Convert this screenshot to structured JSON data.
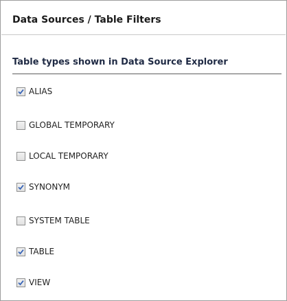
{
  "page": {
    "title": "Data Sources / Table Filters"
  },
  "group": {
    "title": "Table types shown in Data Source Explorer"
  },
  "options": [
    {
      "label": "ALIAS",
      "checked": true
    },
    {
      "label": "GLOBAL TEMPORARY",
      "checked": false
    },
    {
      "label": "LOCAL TEMPORARY",
      "checked": false
    },
    {
      "label": "SYNONYM",
      "checked": true
    },
    {
      "label": "SYSTEM TABLE",
      "checked": false
    },
    {
      "label": "TABLE",
      "checked": true
    },
    {
      "label": "VIEW",
      "checked": true
    }
  ],
  "colors": {
    "checkmark": "#3a66b8",
    "border": "#9c9c9c"
  }
}
